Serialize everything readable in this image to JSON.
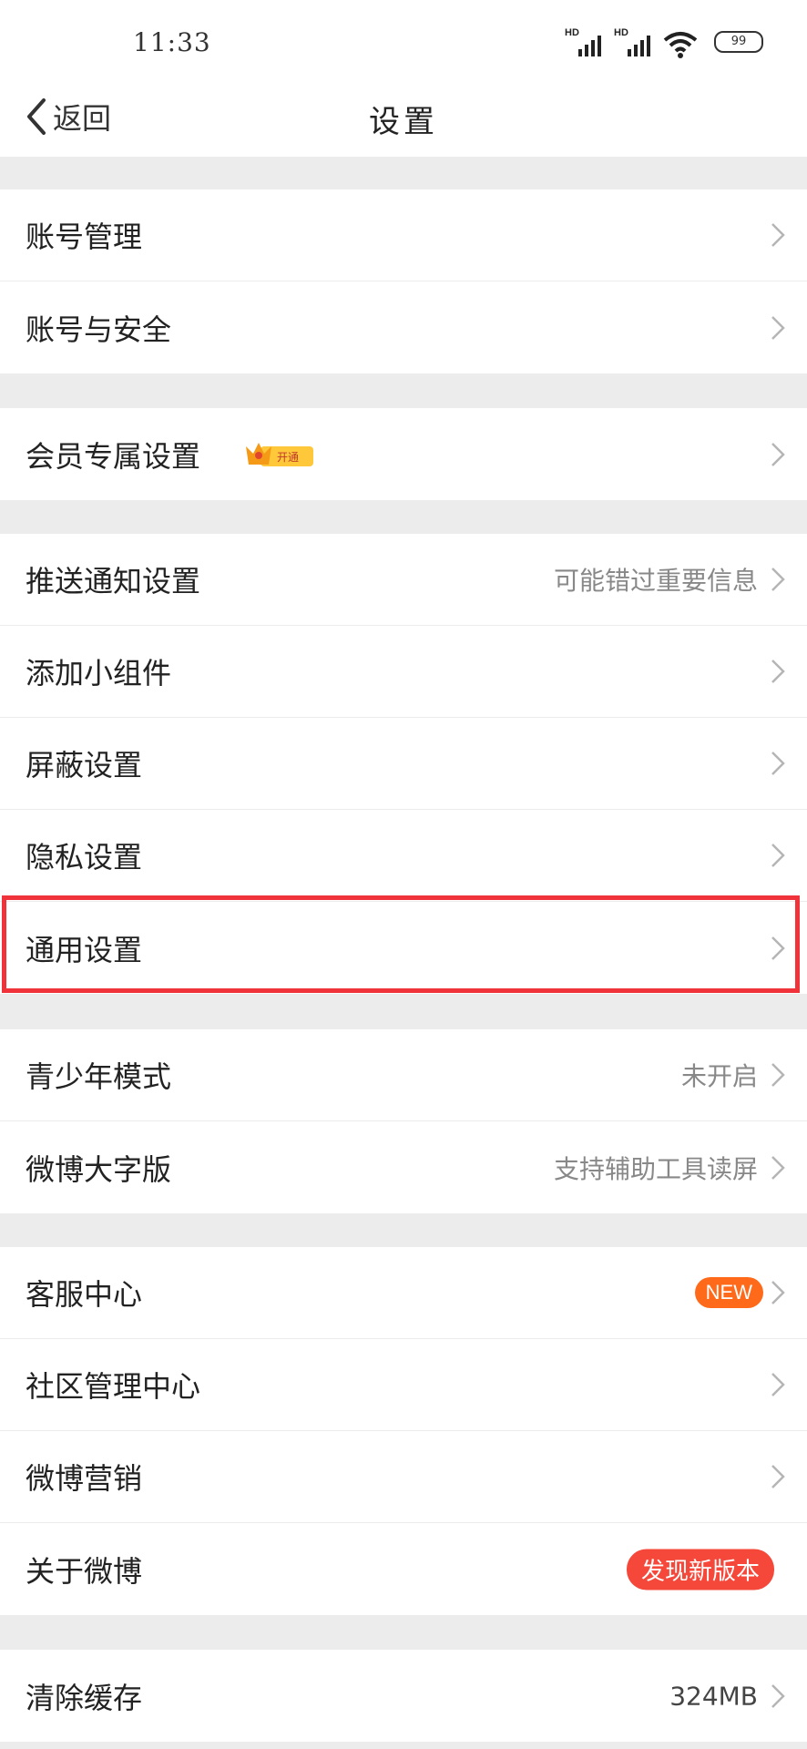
{
  "status_bar": {
    "time": "11:33",
    "signal_label_1": "HD",
    "signal_label_2": "HD",
    "battery": "99"
  },
  "navbar": {
    "back_label": "返回",
    "title": "设置"
  },
  "groups": [
    {
      "rows": [
        {
          "label": "账号管理"
        },
        {
          "label": "账号与安全"
        }
      ]
    },
    {
      "rows": [
        {
          "label": "会员专属设置",
          "badge": "开通"
        }
      ]
    },
    {
      "rows": [
        {
          "label": "推送通知设置",
          "value": "可能错过重要信息"
        },
        {
          "label": "添加小组件"
        },
        {
          "label": "屏蔽设置"
        },
        {
          "label": "隐私设置"
        },
        {
          "label": "通用设置"
        }
      ]
    },
    {
      "rows": [
        {
          "label": "青少年模式",
          "value": "未开启"
        },
        {
          "label": "微博大字版",
          "value": "支持辅助工具读屏"
        }
      ]
    },
    {
      "rows": [
        {
          "label": "客服中心",
          "pill": "NEW"
        },
        {
          "label": "社区管理中心"
        },
        {
          "label": "微博营销"
        },
        {
          "label": "关于微博",
          "pill": "发现新版本"
        }
      ]
    },
    {
      "rows": [
        {
          "label": "清除缓存",
          "value": "324MB"
        }
      ]
    }
  ],
  "colors": {
    "background": "#ececec",
    "highlight_border": "#f0323a",
    "new_pill": "#ff6a1a",
    "update_pill": "#f5483a"
  }
}
